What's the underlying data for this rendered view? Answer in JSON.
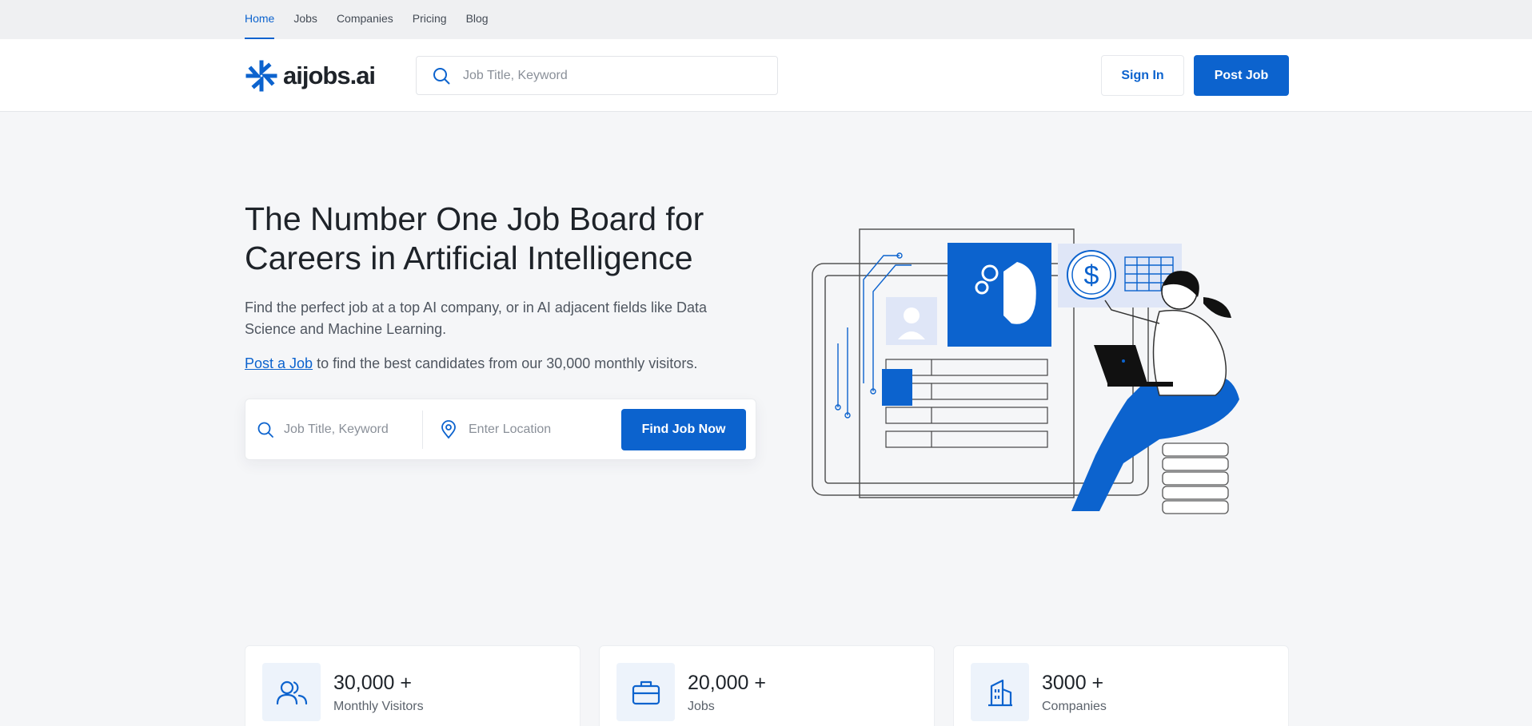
{
  "topnav": {
    "items": [
      {
        "label": "Home",
        "active": true
      },
      {
        "label": "Jobs"
      },
      {
        "label": "Companies"
      },
      {
        "label": "Pricing"
      },
      {
        "label": "Blog"
      }
    ]
  },
  "header": {
    "logo_text": "aijobs.ai",
    "search_placeholder": "Job Title, Keyword",
    "signin_label": "Sign In",
    "post_job_label": "Post Job"
  },
  "hero": {
    "title": "The Number One Job Board for Careers in Artificial Intelligence",
    "subtitle": "Find the perfect job at a top AI company, or in AI adjacent fields like Data Science and Machine Learning.",
    "post_link": "Post a Job",
    "post_rest": " to find the best candidates from our 30,000 monthly visitors."
  },
  "search": {
    "keyword_placeholder": "Job Title, Keyword",
    "location_placeholder": "Enter Location",
    "button_label": "Find Job Now"
  },
  "stats": [
    {
      "value": "30,000 +",
      "label": "Monthly Visitors",
      "icon": "users-icon"
    },
    {
      "value": "20,000 +",
      "label": "Jobs",
      "icon": "briefcase-icon"
    },
    {
      "value": "3000 +",
      "label": "Companies",
      "icon": "building-icon"
    }
  ],
  "colors": {
    "accent": "#0c63ce",
    "text": "#1e2329",
    "muted": "#4f5660",
    "background": "#f5f6f8"
  }
}
